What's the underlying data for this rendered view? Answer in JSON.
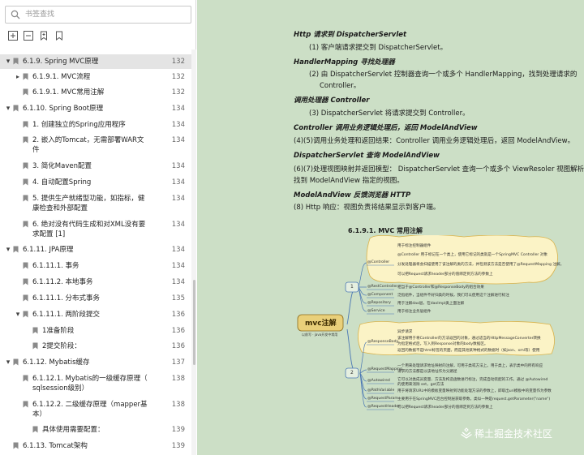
{
  "search": {
    "placeholder": "书签查找"
  },
  "toolbar": {
    "icons": [
      "expand-all-icon",
      "collapse-all-icon",
      "add-bookmark-icon",
      "bookmark-icon"
    ]
  },
  "outline": [
    {
      "label": "6.1.9. Spring MVC原理",
      "page": "132"
    },
    {
      "label": "6.1.9.1. MVC流程",
      "page": "132"
    },
    {
      "label": "6.1.9.1. MVC常用注解",
      "page": "132"
    },
    {
      "label": "6.1.10. Spring Boot原理",
      "page": "134"
    },
    {
      "label": "1. 创建独立的Spring应用程序",
      "page": "134"
    },
    {
      "label": "2. 嵌入的Tomcat，无需部署WAR文",
      "label2": "件",
      "page": "134"
    },
    {
      "label": "3. 简化Maven配置",
      "page": "134"
    },
    {
      "label": "4. 自动配置Spring",
      "page": "134"
    },
    {
      "label": "5. 提供生产就绪型功能，如指标，健",
      "label2": "康检查和外部配置",
      "page": "134"
    },
    {
      "label": "6. 绝对没有代码生成和对XML没有要",
      "label2": "求配置 [1]",
      "page": "134"
    },
    {
      "label": "6.1.11. JPA原理",
      "page": "134"
    },
    {
      "label": "6.1.11.1. 事务",
      "page": "134"
    },
    {
      "label": "6.1.11.2. 本地事务",
      "page": "134"
    },
    {
      "label": "6.1.11.1. 分布式事务",
      "page": "135"
    },
    {
      "label": "6.1.11.1. 两阶段提交",
      "page": "136"
    },
    {
      "label": "1准备阶段",
      "page": "136"
    },
    {
      "label": "2提交阶段：",
      "page": "136"
    },
    {
      "label": "6.1.12. Mybatis缓存",
      "page": "137"
    },
    {
      "label": "6.1.12.1. Mybatis的一级缓存原理（",
      "label2": "sqlsession级别）",
      "page": "138"
    },
    {
      "label": "6.1.12.2. 二级缓存原理（mapper基",
      "label2": "本）",
      "page": "138"
    },
    {
      "label": "具体使用需要配置：",
      "page": "139"
    },
    {
      "label": "6.1.13. Tomcat架构",
      "page": "139"
    }
  ],
  "content": {
    "h1": "Http 请求到 DispatcherServlet",
    "p1": "(1)  客户端请求提交到 DispatcherServlet。",
    "h2": "HandlerMapping 寻找处理器",
    "p2a": "(2)  由  DispatcherServlet  控制器查询一个或多个  HandlerMapping，找到处理请求的",
    "p2b": "Controller。",
    "h3": "调用处理器 Controller",
    "p3": "(3)  DispatcherServlet 将请求提交到 Controller。",
    "h4": "Controller 调用业务逻辑处理后，返回 ModelAndView",
    "p4": "(4)(5)调用业务处理和返回结果：Controller 调用业务逻辑处理后，返回 ModelAndView。",
    "h5": "DispatcherServlet 查询 ModelAndView",
    "p5a": "(6)(7)处理视图映射并返回模型：  DispatcherServlet 查询一个或多个 ViewResoler 视图解析器，",
    "p5b": "找到 ModelAndView 指定的视图。",
    "h6": "ModelAndView 反馈浏览器 HTTP",
    "p6": "(8) Http 响应：视图负责将结果显示到客户端。",
    "section": "6.1.9.1.      MVC 常用注解"
  },
  "mindmap": {
    "root": "mvc注解",
    "root_sub": "以前写 · java开发中常用",
    "group1": "1",
    "group2": "2",
    "controller_node": "@Controller",
    "controller_notes": [
      "用于标注控制器组件",
      "@Controller 用于标记在一个类上，使用它标记的类就是一个SpringMVC Controller 对象",
      "分发处理器将会扫描使用了该注解的类的方法，并检测该方法是否使用了@RequestMapping 注解。",
      "可以把Request请求header部分的值绑定到方法的参数上"
    ],
    "nodes_a": [
      {
        "name": "@RestController",
        "note": "相当于@Controller和@ResponseBody的组合效果"
      },
      {
        "name": "@Component",
        "note": "泛指组件，当组件不好归类的时候，我们可以使用这个注解进行标注"
      },
      {
        "name": "@Repository",
        "note": "用于注解dao层，在daoImpl类上面注解"
      },
      {
        "name": "@Service",
        "note": "用于标注业务层组件"
      }
    ],
    "responsebody_node": "@ResponseBody",
    "responsebody_notes": [
      "异步请求",
      "该注解用于将Controller的方法返回的对象，通过适当的HttpMessageConverter转换",
      "为指定格式后，写入到Response对象的body数据区。",
      "返回的数据不是html标签的页面，而是其他某种格式的数据时（如json、xml等）使用"
    ],
    "requestmapping_node": "@RequestMapping",
    "requestmapping_notes": [
      "一个用来处理请求地址映射的注解，可用于类或方法上。用于类上，表示类中的所有响应",
      "请求的方法都是以该地址作为父路径"
    ],
    "nodes_b": [
      {
        "name": "@Autowired",
        "note": "它可以对类成员变量、方法及构造函数进行标注，完成自动装配的工作。通过 @Autowired的使用来消除 set，get方法"
      },
      {
        "name": "@PathVariable",
        "note": "用于将请求URL中的模板变量映射到功能处理方法的参数上，即取出uri模板中的变量作为参数"
      },
      {
        "name": "@RequestParam",
        "note": "主要用于在SpringMVC后台控制层获取参数，类似一种是request.getParameter(\"name\")"
      },
      {
        "name": "@RequestHeader",
        "note": "可以把Request请求header部分的值绑定到方法的参数上"
      }
    ]
  },
  "watermark": "稀土掘金技术社区",
  "colors": {
    "page_bg": "#ccdfc6",
    "selected_row": "#e4e4e4",
    "mindmap_fill": "#fbf3c6",
    "mindmap_blue": "#4a77b4",
    "root_fill": "#e9d07a"
  }
}
